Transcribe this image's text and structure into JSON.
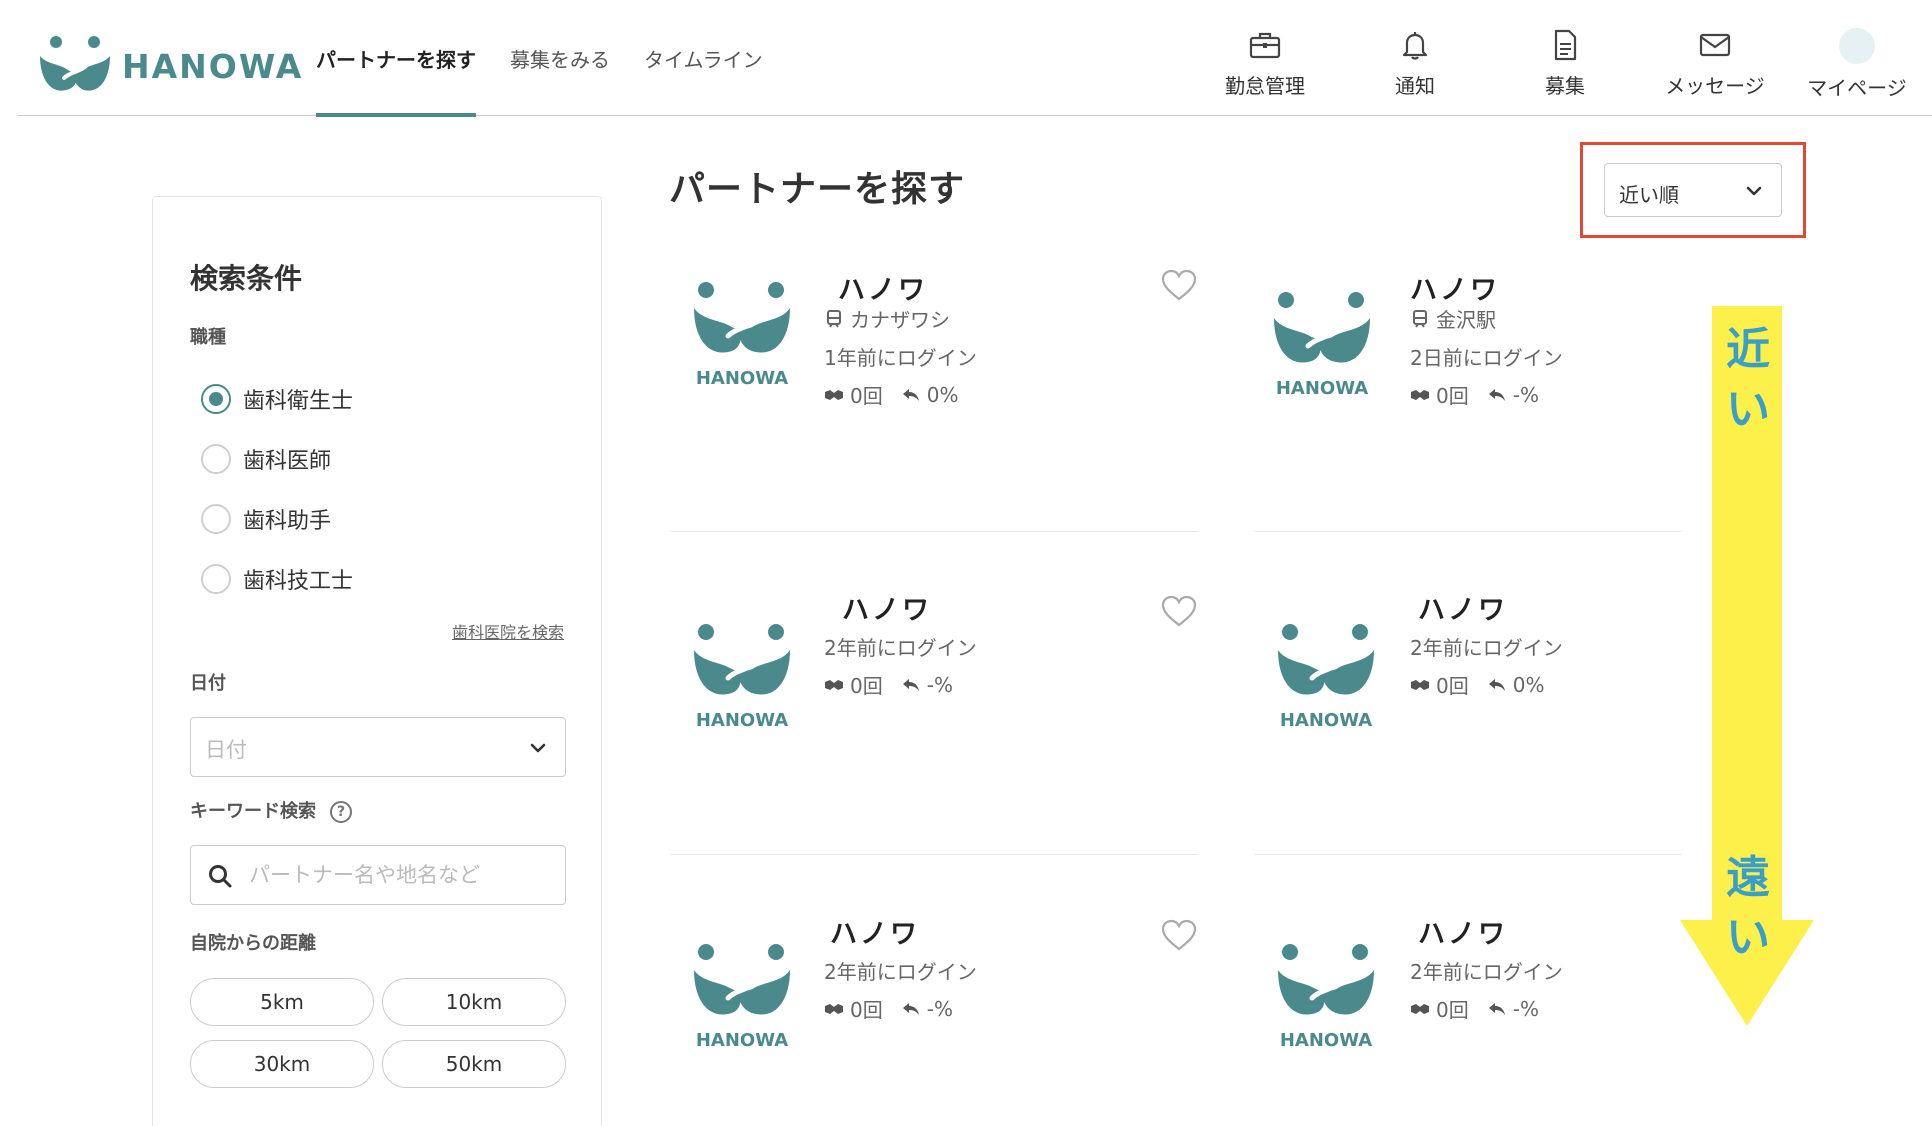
{
  "brand": {
    "name": "HANOWA",
    "accent_color": "#4a8a8c"
  },
  "nav_tabs": [
    {
      "label": "パートナーを探す",
      "active": true
    },
    {
      "label": "募集をみる",
      "active": false
    },
    {
      "label": "タイムライン",
      "active": false
    }
  ],
  "header_nav": [
    {
      "label": "勤怠管理",
      "icon": "briefcase-icon"
    },
    {
      "label": "通知",
      "icon": "bell-icon"
    },
    {
      "label": "募集",
      "icon": "document-icon"
    },
    {
      "label": "メッセージ",
      "icon": "envelope-icon"
    },
    {
      "label": "マイページ",
      "icon": "avatar"
    }
  ],
  "page_title": "パートナーを探す",
  "sort": {
    "selected": "近い順",
    "highlight_color": "#e04a32"
  },
  "sidebar": {
    "title": "検索条件",
    "job_label": "職種",
    "job_options": [
      {
        "label": "歯科衛生士",
        "selected": true
      },
      {
        "label": "歯科医師",
        "selected": false
      },
      {
        "label": "歯科助手",
        "selected": false
      },
      {
        "label": "歯科技工士",
        "selected": false
      }
    ],
    "clinic_search_link": "歯科医院を検索",
    "date_label": "日付",
    "date_placeholder": "日付",
    "keyword_label": "キーワード検索",
    "keyword_help": "?",
    "keyword_placeholder": "パートナー名や地名など",
    "distance_label": "自院からの距離",
    "distance_options": [
      "5km",
      "10km",
      "30km",
      "50km"
    ]
  },
  "partners": [
    {
      "name": "ハノワ",
      "station": "カナザワシ",
      "last_login": "1年前にログイン",
      "count": "0回",
      "rate": "0%",
      "logo_text": "HANOWA",
      "favorite": true
    },
    {
      "name": "ハノワ",
      "station": "金沢駅",
      "last_login": "2日前にログイン",
      "count": "0回",
      "rate": "-%",
      "logo_text": "HANOWA",
      "favorite": false
    },
    {
      "name": "ハノワ",
      "station": null,
      "last_login": "2年前にログイン",
      "count": "0回",
      "rate": "-%",
      "logo_text": "HANOWA",
      "favorite": true
    },
    {
      "name": "ハノワ",
      "station": null,
      "last_login": "2年前にログイン",
      "count": "0回",
      "rate": "0%",
      "logo_text": "HANOWA",
      "favorite": false
    },
    {
      "name": "ハノワ",
      "station": null,
      "last_login": "2年前にログイン",
      "count": "0回",
      "rate": "-%",
      "logo_text": "HANOWA",
      "favorite": true
    },
    {
      "name": "ハノワ",
      "station": null,
      "last_login": "2年前にログイン",
      "count": "0回",
      "rate": "-%",
      "logo_text": "HANOWA",
      "favorite": false
    }
  ],
  "annotation": {
    "near": "近い",
    "far": "遠い",
    "arrow_color": "#fdf04a",
    "text_color": "#3a9fc8"
  }
}
